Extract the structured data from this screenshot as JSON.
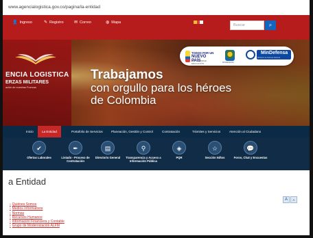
{
  "browser": {
    "url": "www.agencialogistica.gov.co/pagina/la-entidad"
  },
  "topbar": {
    "items": [
      {
        "label": "Ingreso",
        "icon": "user-icon"
      },
      {
        "label": "Registro",
        "icon": "pencil-icon"
      },
      {
        "label": "Correo",
        "icon": "mail-icon"
      },
      {
        "label": "Mapa",
        "icon": "globe-icon"
      }
    ],
    "search_placeholder": "Buscar",
    "search_button_icon": "search-icon"
  },
  "hero": {
    "brand_line1": "ENCIA LOGISTICA",
    "brand_line2": "ERZAS MILITARES",
    "brand_line3": "ación de nuestras Fuerzas",
    "headline_1": "Trabajamos",
    "headline_2": "con orgullo para los héroes",
    "headline_3": "de Colombia",
    "logo_pais_top": "TODOS POR UN",
    "logo_pais_main": "NUEVO PAÍS",
    "logo_pais_sub": "PAZ · EQUIDAD · EDUCACIÓN",
    "logo_mindefensa_seal_caption": "MINDEFENSA",
    "logo_mindefensa": "MinDefensa",
    "logo_mindefensa_sub": "Ministerio de Defensa Nacional"
  },
  "nav": {
    "items": [
      "Inicio",
      "La Entidad",
      "Portafolio de Servicios",
      "Planeación, Gestión y Control",
      "Contratación",
      "Trámites y Servicios",
      "Atención al Ciudadano"
    ],
    "active": "La Entidad"
  },
  "quick_links": [
    {
      "label": "Ofertas Laborales",
      "icon": "check-icon"
    },
    {
      "label": "Listado - Proceso de Contratación",
      "icon": "pen-icon"
    },
    {
      "label": "Directorio General",
      "icon": "document-icon"
    },
    {
      "label": "Transparencia y Acceso a Información Pública",
      "icon": "location-pin-icon"
    },
    {
      "label": "PQR",
      "icon": "diamond-icon"
    },
    {
      "label": "Sección Niños",
      "icon": "star-icon"
    },
    {
      "label": "Foros, Chat y Encuestas",
      "icon": "chat-icon"
    }
  ],
  "page": {
    "title": "a Entidad",
    "font_increase": "A",
    "font_decrease": "A",
    "links": [
      "Quiénes Somos",
      "Medios Informativos",
      "Normas",
      "Recursos Humanos",
      "Información Financiera y Contable",
      "Grupo de Modernización ALFM"
    ]
  },
  "colors": {
    "topbar": "#b71c1c",
    "nav": "#0b2a45",
    "active_tab": "#c62828",
    "link": "#c62828"
  }
}
